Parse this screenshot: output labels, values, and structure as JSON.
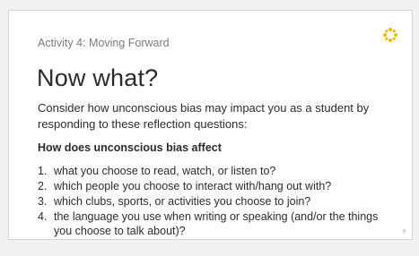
{
  "slide": {
    "activity_label": "Activity 4: Moving Forward",
    "title": "Now what?",
    "intro": "Consider how unconscious bias may impact you as a student by responding to these reflection questions:",
    "subheading": "How does unconscious bias affect",
    "questions": [
      {
        "number": "1.",
        "text": "what you choose to read, watch, or listen to?"
      },
      {
        "number": "2.",
        "text": "which people you choose to interact with/hang out with?"
      },
      {
        "number": "3.",
        "text": "which clubs, sports, or activities you choose to join?"
      },
      {
        "number": "4.",
        "text": "the language you use when writing or speaking (and/or the things you choose to talk about)?"
      }
    ],
    "slide_number": "8"
  },
  "logo": {
    "icon": "loading-dots-icon",
    "color": "#f5b800"
  },
  "colors": {
    "background": "#f1f1f1",
    "slide": "#ffffff",
    "text": "#2b2b2b",
    "muted": "#7a7a7a"
  }
}
